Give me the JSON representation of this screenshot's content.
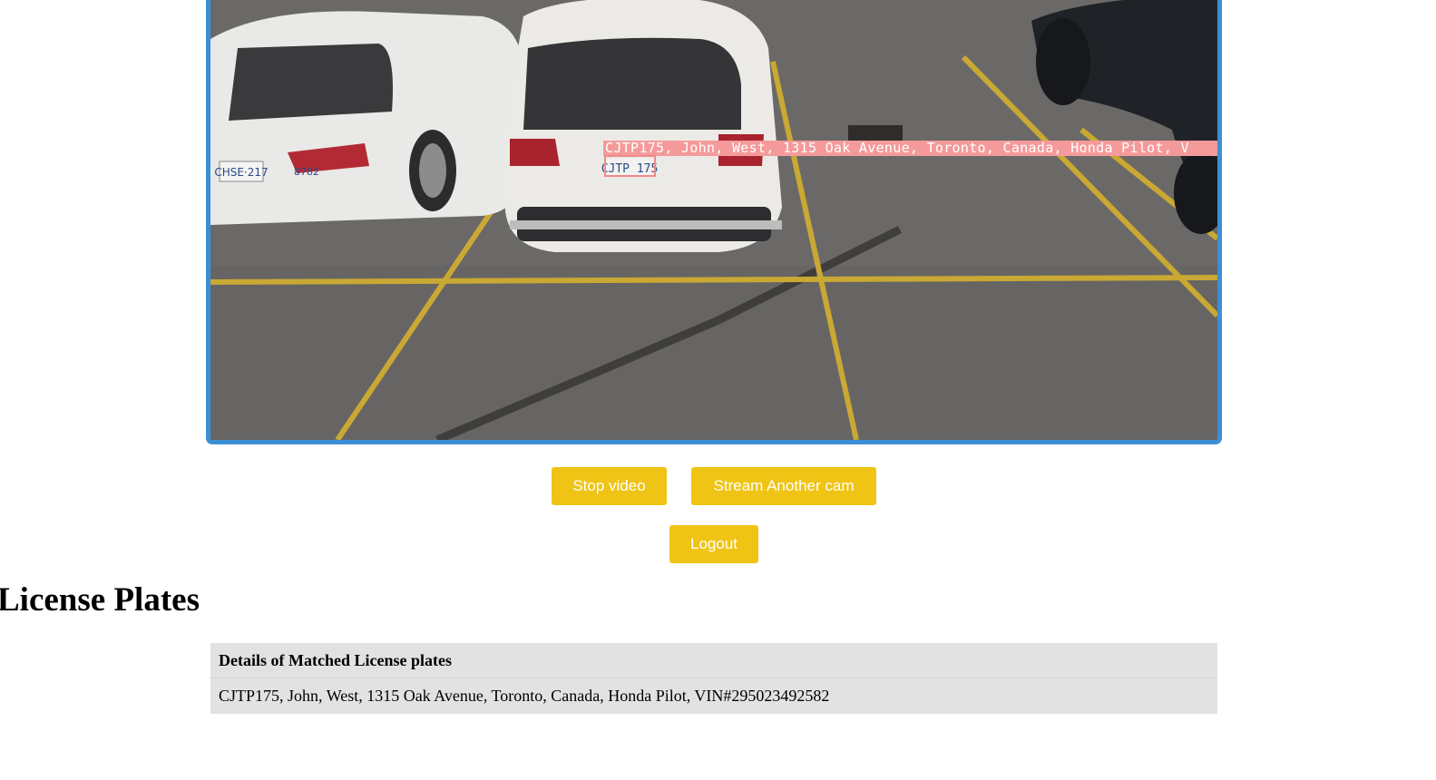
{
  "video": {
    "overlay_text": "CJTP175, John, West, 1315 Oak Avenue, Toronto, Canada, Honda Pilot, V",
    "plate_text": "CJTP 175",
    "left_car_plate": "CHSE·217",
    "left_car_number": "8782",
    "border_color": "#3b8fd6",
    "overlay_color": "#f59a9a"
  },
  "controls": {
    "stop_label": "Stop video",
    "stream_label": "Stream Another cam",
    "logout_label": "Logout",
    "button_color": "#efc414"
  },
  "section": {
    "title": "License Plates"
  },
  "table": {
    "header": "Details of Matched License plates",
    "rows": [
      "CJTP175, John, West, 1315 Oak Avenue, Toronto, Canada, Honda Pilot, VIN#295023492582"
    ]
  }
}
